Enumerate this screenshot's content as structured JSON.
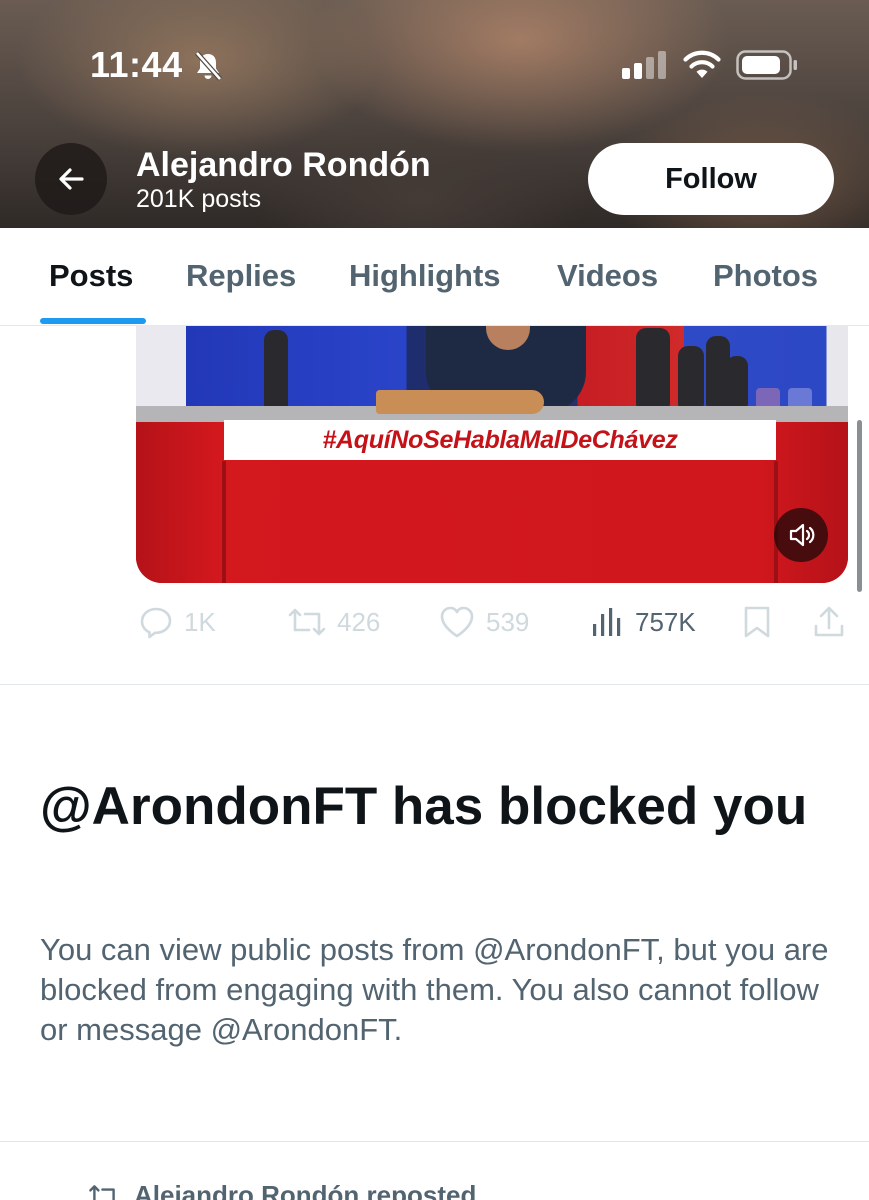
{
  "status_bar": {
    "time": "11:44",
    "icons": [
      "bell-slash-icon",
      "cellular-signal-icon",
      "wifi-icon",
      "battery-icon"
    ]
  },
  "header": {
    "profile_name": "Alejandro Rondón",
    "post_count": "201K posts",
    "follow_label": "Follow"
  },
  "tabs": [
    {
      "label": "Posts",
      "active": true
    },
    {
      "label": "Replies",
      "active": false
    },
    {
      "label": "Highlights",
      "active": false
    },
    {
      "label": "Videos",
      "active": false
    },
    {
      "label": "Photos",
      "active": false
    }
  ],
  "post": {
    "video_caption": "#AquíNoSeHablaMalDeChávez",
    "stats": {
      "replies": "1K",
      "reposts": "426",
      "likes": "539",
      "views": "757K"
    }
  },
  "blocked_notice": {
    "title": "@ArondonFT has blocked you",
    "body": "You can view public posts from @ArondonFT, but you are blocked from engaging with them. You also cannot follow or message @ArondonFT."
  },
  "next_item": {
    "repost_text": "Alejandro Rondón reposted"
  },
  "colors": {
    "accent": "#1d9bf0",
    "text_primary": "#0f1419",
    "text_secondary": "#536471"
  }
}
